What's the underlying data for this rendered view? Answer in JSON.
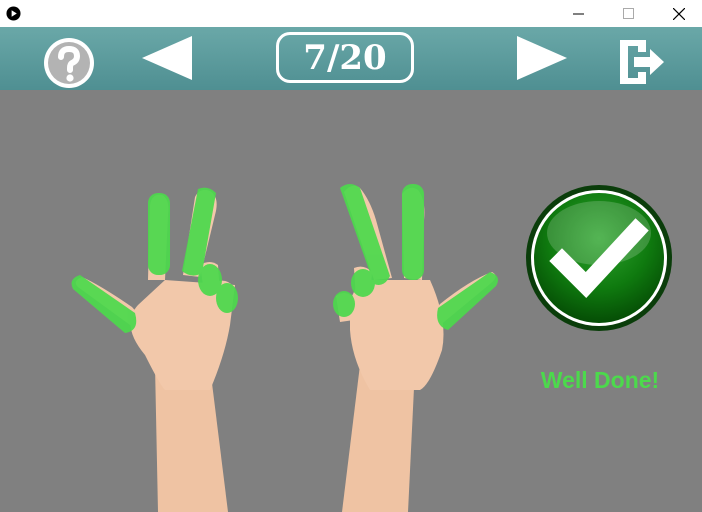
{
  "window": {
    "minimize_label": "—",
    "maximize_label": "☐",
    "close_label": "✕"
  },
  "toolbar": {
    "help_icon": "question-circle-icon",
    "prev_icon": "triangle-left-icon",
    "next_icon": "triangle-right-icon",
    "exit_icon": "exit-door-icon",
    "counter": "7/20"
  },
  "exercise": {
    "left_hand_fingers_highlighted": 5,
    "right_hand_fingers_highlighted": 5,
    "highlight_color": "#4cd94c"
  },
  "result": {
    "icon": "checkmark-circle-icon",
    "message": "Well Done!"
  }
}
